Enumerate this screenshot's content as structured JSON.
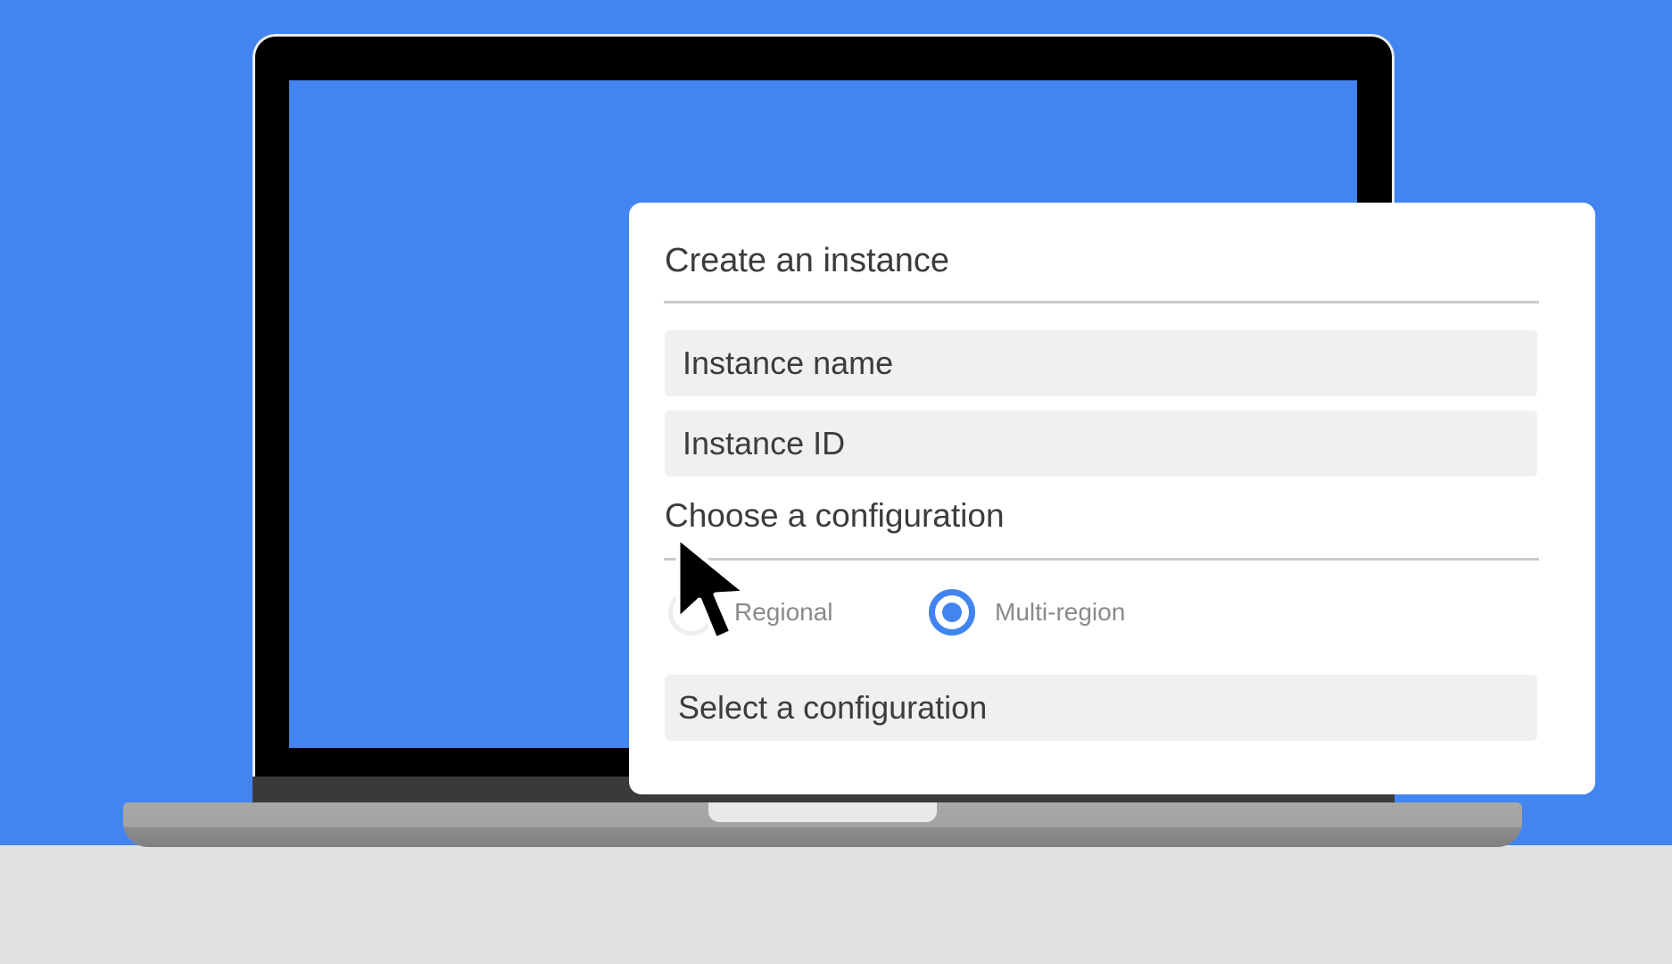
{
  "dialog": {
    "title": "Create an instance",
    "instance_name_placeholder": "Instance name",
    "instance_id_placeholder": "Instance ID",
    "configuration_heading": "Choose a configuration",
    "radio_options": [
      {
        "label": "Regional",
        "selected": false
      },
      {
        "label": "Multi-region",
        "selected": true
      }
    ],
    "select_placeholder": "Select a configuration"
  },
  "colors": {
    "background": "#4285f0",
    "accent": "#4285f0",
    "desk": "#e1e3e3"
  },
  "icons": {
    "cursor": "mouse-pointer-icon"
  }
}
